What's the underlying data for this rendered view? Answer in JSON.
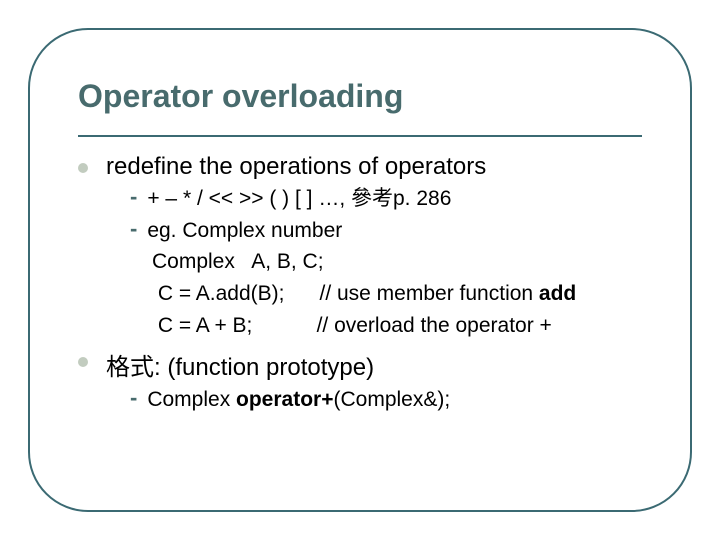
{
  "title": "Operator overloading",
  "items": {
    "redefine": "redefine the operations of operators",
    "ops": "+   –   *   /   <<   >>  ( )   [ ]  …,  參考p. 286",
    "eg": "eg.  Complex number",
    "decl": "Complex   A, B, C;",
    "add1_pre": " C = A.add(B);      // use member function ",
    "add1_bold": "add",
    "add2": " C = A + B;           // overload the operator +",
    "format": "格式: (function prototype)",
    "proto_pre": "Complex  ",
    "proto_bold": "operator+",
    "proto_post": "(Complex&);"
  }
}
